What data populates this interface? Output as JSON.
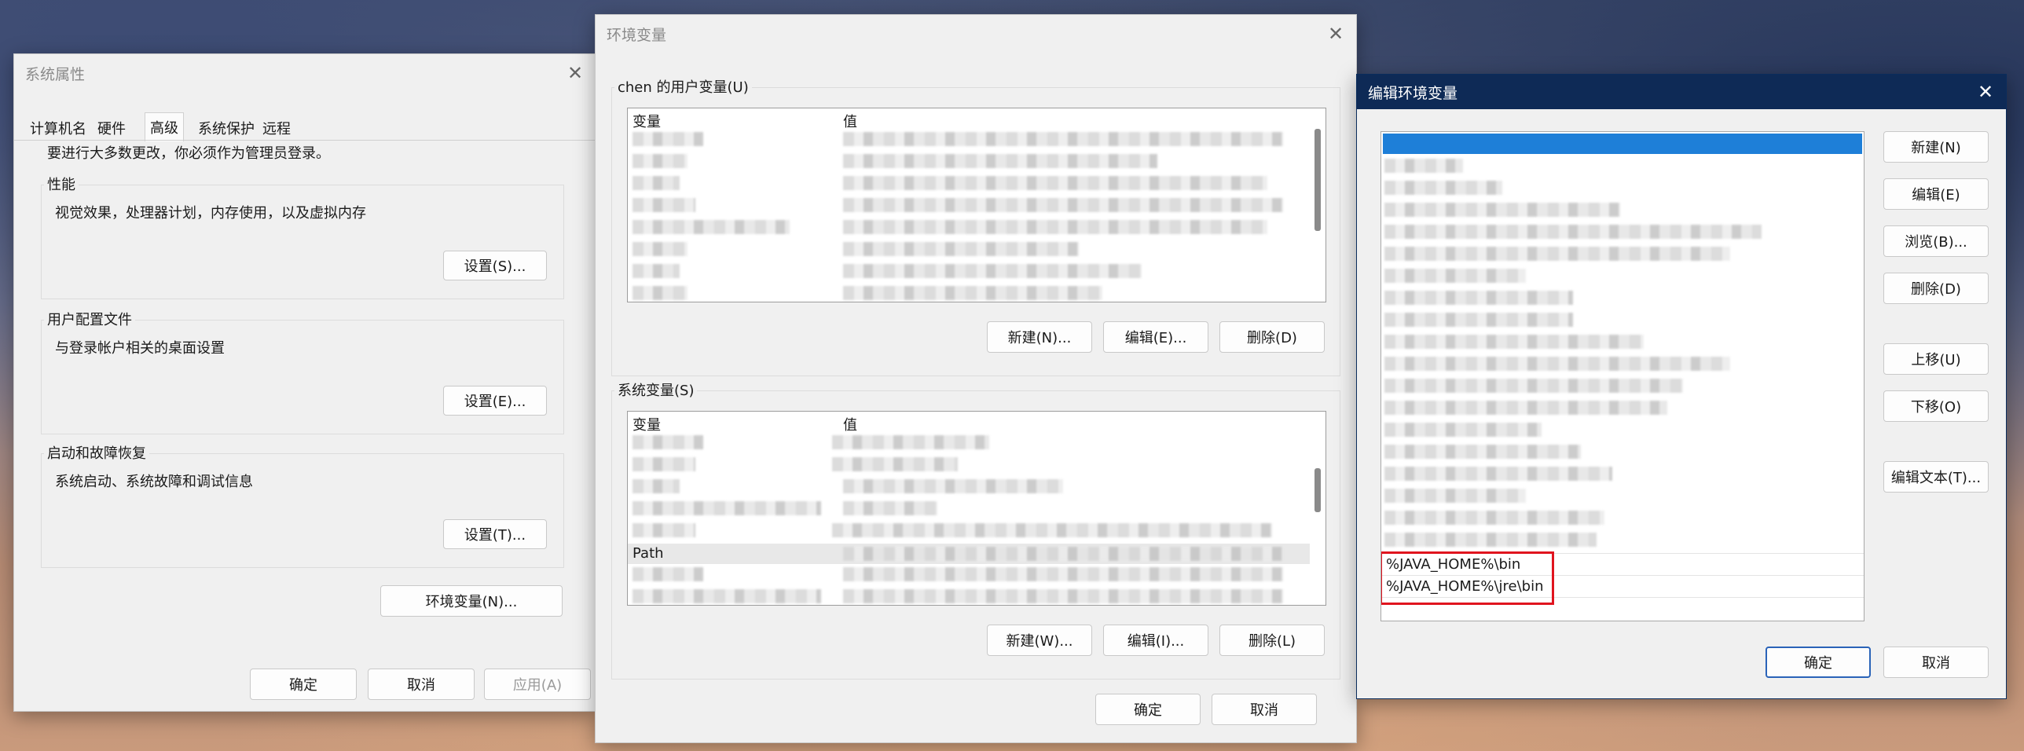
{
  "sysprops": {
    "title": "系统属性",
    "tabs": [
      "计算机名",
      "硬件",
      "高级",
      "系统保护",
      "远程"
    ],
    "admin_note": "要进行大多数更改，你必须作为管理员登录。",
    "performance": {
      "label": "性能",
      "desc": "视觉效果，处理器计划，内存使用，以及虚拟内存",
      "button": "设置(S)..."
    },
    "user_profile": {
      "label": "用户配置文件",
      "desc": "与登录帐户相关的桌面设置",
      "button": "设置(E)..."
    },
    "startup": {
      "label": "启动和故障恢复",
      "desc": "系统启动、系统故障和调试信息",
      "button": "设置(T)..."
    },
    "env_button": "环境变量(N)...",
    "ok": "确定",
    "cancel": "取消",
    "apply": "应用(A)"
  },
  "envvars": {
    "title": "环境变量",
    "user_group": "chen 的用户变量(U)",
    "col_var": "变量",
    "col_val": "值",
    "user_buttons": {
      "new": "新建(N)...",
      "edit": "编辑(E)...",
      "delete": "删除(D)"
    },
    "system_group": "系统变量(S)",
    "path_row": "Path",
    "system_buttons": {
      "new": "新建(W)...",
      "edit": "编辑(I)...",
      "delete": "删除(L)"
    },
    "ok": "确定",
    "cancel": "取消"
  },
  "editenv": {
    "title": "编辑环境变量",
    "path_entries": [
      "%JAVA_HOME%\\bin",
      "%JAVA_HOME%\\jre\\bin"
    ],
    "buttons": {
      "new": "新建(N)",
      "edit": "编辑(E)",
      "browse": "浏览(B)...",
      "delete": "删除(D)",
      "up": "上移(U)",
      "down": "下移(O)",
      "edit_text": "编辑文本(T)..."
    },
    "ok": "确定",
    "cancel": "取消",
    "accent": "#1e7fd8",
    "highlight": "#e0141e"
  }
}
